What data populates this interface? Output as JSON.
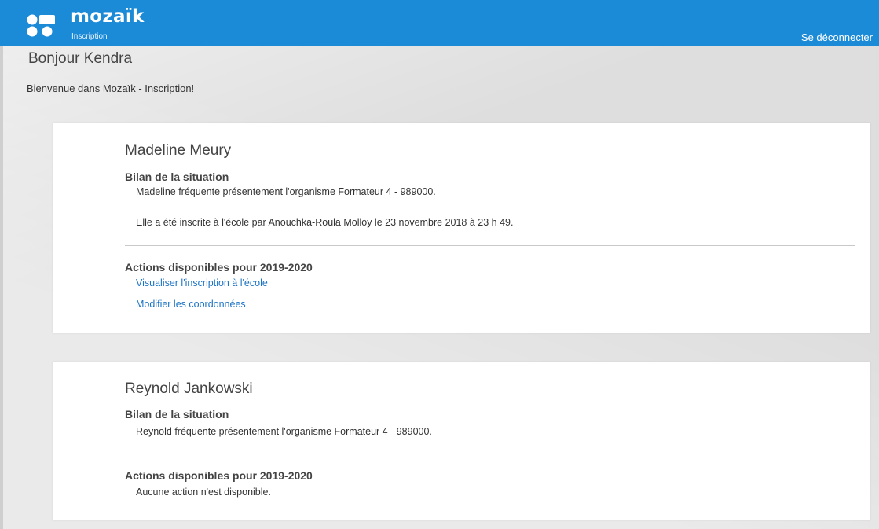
{
  "header": {
    "brand": "mozaïk",
    "subtitle": "Inscription",
    "logout_label": "Se déconnecter",
    "accent_color": "#1b8ad7"
  },
  "greeting": "Bonjour Kendra",
  "welcome": "Bienvenue dans Mozaïk - Inscription!",
  "students": [
    {
      "name": "Madeline Meury",
      "situation_title": "Bilan de la situation",
      "situation_lines": [
        "Madeline fréquente présentement l'organisme Formateur 4 - 989000.",
        "Elle a été inscrite à l'école par Anouchka-Roula Molloy le 23 novembre 2018 à 23 h 49."
      ],
      "actions_title": "Actions disponibles pour 2019-2020",
      "actions": [
        "Visualiser l'inscription à l'école",
        "Modifier les coordonnées"
      ]
    },
    {
      "name": "Reynold Jankowski",
      "situation_title": "Bilan de la situation",
      "situation_lines": [
        "Reynold fréquente présentement l'organisme Formateur 4 - 989000."
      ],
      "actions_title": "Actions disponibles pour 2019-2020",
      "no_action": "Aucune action n'est disponible."
    }
  ]
}
